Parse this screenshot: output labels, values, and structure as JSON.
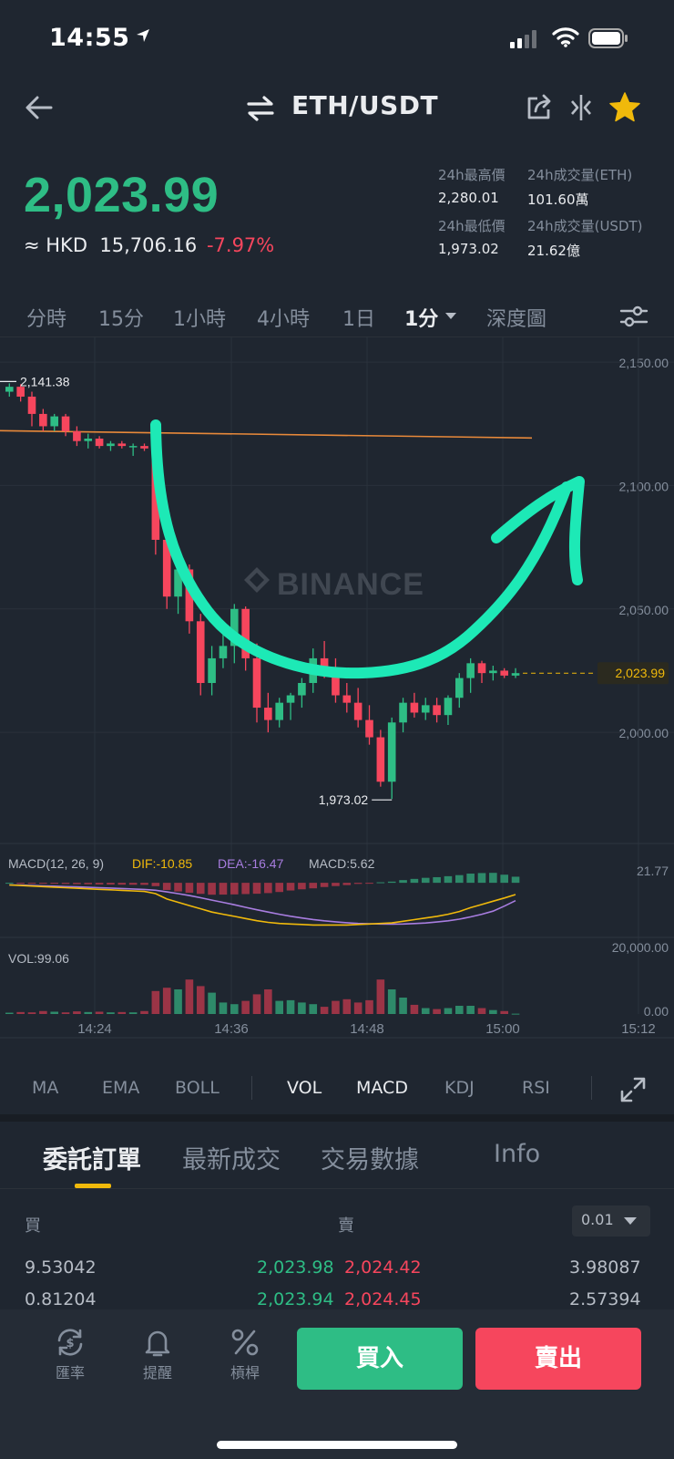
{
  "status": {
    "time": "14:55"
  },
  "nav": {
    "pair": "ETH/USDT"
  },
  "ticker": {
    "last_price": "2,023.99",
    "fiat_prefix": "≈ HKD",
    "fiat_value": "15,706.16",
    "change_pct": "-7.97%",
    "stats": [
      {
        "label": "24h最高價",
        "value": "2,280.01"
      },
      {
        "label": "24h成交量(ETH)",
        "value": "101.60萬"
      },
      {
        "label": "24h最低價",
        "value": "1,973.02"
      },
      {
        "label": "24h成交量(USDT)",
        "value": "21.62億"
      }
    ]
  },
  "timeframes": [
    "分時",
    "15分",
    "1小時",
    "4小時",
    "1日",
    "1分",
    "深度圖"
  ],
  "active_timeframe": "1分",
  "chart_data": {
    "type": "candlestick",
    "watermark": "BINANCE",
    "y_ticks": [
      "2,150.00",
      "2,100.00",
      "2,050.00",
      "2,000.00"
    ],
    "ylim": [
      1962,
      2160
    ],
    "x_ticks": [
      "14:24",
      "14:36",
      "14:48",
      "15:00",
      "15:12"
    ],
    "high_label": "2,141.38",
    "low_label": "1,973.02",
    "last_price_label": "2,023.99",
    "drawn_hline": 2120,
    "candles": [
      [
        2138,
        2141.38,
        2136,
        2140
      ],
      [
        2140,
        2141,
        2134,
        2136
      ],
      [
        2136,
        2138,
        2124,
        2129
      ],
      [
        2129,
        2131,
        2122,
        2124
      ],
      [
        2124,
        2129,
        2122,
        2128
      ],
      [
        2128,
        2129,
        2120,
        2122
      ],
      [
        2122,
        2124,
        2116,
        2118
      ],
      [
        2118,
        2121,
        2115,
        2119
      ],
      [
        2119,
        2120,
        2115,
        2116
      ],
      [
        2116,
        2118,
        2114,
        2117
      ],
      [
        2117,
        2118,
        2115,
        2116
      ],
      [
        2116,
        2117,
        2112,
        2116
      ],
      [
        2116,
        2117,
        2114,
        2115
      ],
      [
        2115,
        2116,
        2072,
        2078
      ],
      [
        2078,
        2080,
        2050,
        2055
      ],
      [
        2055,
        2070,
        2048,
        2066
      ],
      [
        2066,
        2068,
        2040,
        2045
      ],
      [
        2045,
        2048,
        2015,
        2020
      ],
      [
        2020,
        2035,
        2015,
        2030
      ],
      [
        2030,
        2040,
        2026,
        2035
      ],
      [
        2035,
        2052,
        2028,
        2050
      ],
      [
        2050,
        2051,
        2025,
        2030
      ],
      [
        2030,
        2036,
        2004,
        2010
      ],
      [
        2010,
        2016,
        2000,
        2005
      ],
      [
        2005,
        2014,
        2002,
        2012
      ],
      [
        2012,
        2016,
        2005,
        2015
      ],
      [
        2015,
        2022,
        2010,
        2020
      ],
      [
        2020,
        2034,
        2016,
        2030
      ],
      [
        2030,
        2037,
        2022,
        2025
      ],
      [
        2025,
        2030,
        2012,
        2015
      ],
      [
        2015,
        2020,
        2008,
        2012
      ],
      [
        2012,
        2018,
        2002,
        2005
      ],
      [
        2005,
        2011,
        1995,
        1998
      ],
      [
        1998,
        2001,
        1978,
        1980
      ],
      [
        1980,
        2006,
        1973.02,
        2004
      ],
      [
        2004,
        2014,
        2000,
        2012
      ],
      [
        2012,
        2016,
        2006,
        2008
      ],
      [
        2008,
        2014,
        2005,
        2011
      ],
      [
        2011,
        2014,
        2004,
        2007
      ],
      [
        2007,
        2015,
        2003,
        2014
      ],
      [
        2014,
        2024,
        2010,
        2022
      ],
      [
        2022,
        2030,
        2016,
        2028
      ],
      [
        2028,
        2029,
        2020,
        2024
      ],
      [
        2024,
        2027,
        2021,
        2025
      ],
      [
        2025,
        2026,
        2022,
        2023
      ],
      [
        2023,
        2026,
        2022,
        2023.99
      ]
    ],
    "macd": {
      "label": "MACD(12, 26, 9)",
      "dif_label": "DIF:-10.85",
      "dea_label": "DEA:-16.47",
      "macd_label": "MACD:5.62",
      "axis_top": "21.77",
      "ylim": [
        -42,
        22
      ],
      "dif": [
        -2,
        -2.5,
        -3,
        -3.5,
        -4,
        -4.5,
        -5,
        -5.5,
        -6,
        -6.5,
        -7,
        -7.5,
        -8,
        -10,
        -15,
        -18,
        -21,
        -24,
        -27,
        -29,
        -31,
        -33,
        -35,
        -36.5,
        -37.5,
        -38,
        -38.5,
        -39,
        -39,
        -39,
        -39,
        -38.5,
        -38,
        -37.5,
        -37,
        -35.5,
        -34,
        -32.5,
        -31,
        -29,
        -26.5,
        -23,
        -20,
        -17,
        -14,
        -10.85
      ],
      "dea": [
        -2,
        -2.2,
        -2.5,
        -2.8,
        -3.1,
        -3.5,
        -3.8,
        -4.2,
        -4.5,
        -4.9,
        -5.3,
        -5.7,
        -6.1,
        -6.9,
        -8.4,
        -10,
        -11.8,
        -13.8,
        -16,
        -18.1,
        -20.3,
        -22.6,
        -24.9,
        -27,
        -29,
        -30.9,
        -32.5,
        -33.9,
        -35.1,
        -36,
        -36.9,
        -37.5,
        -37.8,
        -38,
        -38.1,
        -38,
        -37.6,
        -37.1,
        -36.2,
        -35.1,
        -33.6,
        -31.5,
        -29,
        -26.2,
        -21.5,
        -16.47
      ],
      "hist": [
        0,
        -0.3,
        -0.5,
        -0.7,
        -0.9,
        -1,
        -1.2,
        -1.3,
        -1.5,
        -1.6,
        -1.7,
        -1.8,
        -1.9,
        -3.1,
        -6.6,
        -8,
        -9.2,
        -10.2,
        -11,
        -10.9,
        -10.7,
        -10.4,
        -10.1,
        -9.5,
        -8.5,
        -7.1,
        -6,
        -5.1,
        -3.9,
        -3,
        -2.1,
        -1,
        -0.2,
        0.5,
        1.1,
        2.5,
        3.6,
        4.6,
        5.2,
        6.1,
        7.1,
        8.5,
        9,
        9.2,
        7.5,
        5.62
      ]
    },
    "volume": {
      "label": "VOL:99.06",
      "axis_top": "20,000.00",
      "axis_bottom": "0.00",
      "ylim": [
        0,
        20000
      ],
      "values": [
        400,
        600,
        500,
        900,
        700,
        500,
        800,
        600,
        700,
        500,
        600,
        500,
        900,
        7000,
        8000,
        7500,
        10500,
        8500,
        6500,
        3500,
        3000,
        4000,
        6000,
        7500,
        4000,
        4200,
        3500,
        3000,
        2200,
        4000,
        4500,
        3500,
        4200,
        10500,
        7500,
        5000,
        2800,
        1800,
        1500,
        1800,
        2500,
        2500,
        1800,
        1200,
        900,
        99.06
      ]
    }
  },
  "indicators": [
    "MA",
    "EMA",
    "BOLL",
    "VOL",
    "MACD",
    "KDJ",
    "RSI"
  ],
  "active_indicators": [
    "VOL",
    "MACD"
  ],
  "orderbook": {
    "tabs": [
      "委託訂單",
      "最新成交",
      "交易數據",
      "Info"
    ],
    "active_tab": "委託訂單",
    "buy_label": "買",
    "sell_label": "賣",
    "precision": "0.01",
    "rows": [
      {
        "bid_qty": "9.53042",
        "bid_price": "2,023.98",
        "ask_price": "2,024.42",
        "ask_qty": "3.98087"
      },
      {
        "bid_qty": "0.81204",
        "bid_price": "2,023.94",
        "ask_price": "2,024.45",
        "ask_qty": "2.57394"
      }
    ]
  },
  "bottom_bar": {
    "items": [
      {
        "label": "匯率",
        "icon": "exchange-rate-icon"
      },
      {
        "label": "提醒",
        "icon": "bell-icon"
      },
      {
        "label": "槓桿",
        "icon": "percent-icon"
      }
    ],
    "buy": "買入",
    "sell": "賣出"
  },
  "colors": {
    "up": "#2ebd85",
    "down": "#f6465d",
    "up_muted": "#2e8a6a",
    "down_muted": "#9b3446",
    "accent": "#f0b90b",
    "annotation": "#1de9b6",
    "hline": "#e8893a"
  }
}
